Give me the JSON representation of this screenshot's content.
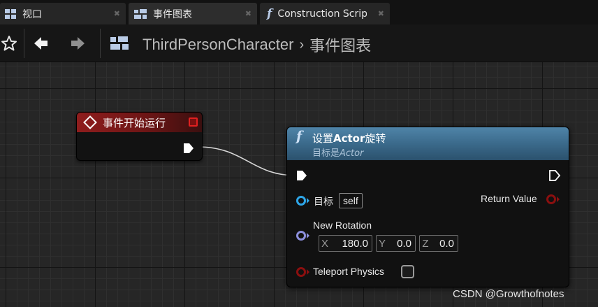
{
  "tabs": [
    {
      "label": "视口",
      "icon": "viewport-icon"
    },
    {
      "label": "事件图表",
      "icon": "event-graph-icon"
    },
    {
      "label": "Construction Scrip",
      "icon": "function-icon"
    }
  ],
  "toolbar": {
    "buttons": [
      "favorite-star-icon",
      "back-arrow-icon",
      "forward-arrow-icon",
      "blueprint-graph-icon"
    ],
    "breadcrumb": {
      "root": "ThirdPersonCharacter",
      "separator": "›",
      "current": "事件图表"
    }
  },
  "event_node": {
    "title": "事件开始运行",
    "header_color": "#8f1d1d"
  },
  "function_node": {
    "title_prefix": "设置",
    "title_bold": "Actor",
    "title_suffix": "旋转",
    "subtitle_prefix": "目标是",
    "subtitle_italic": "Actor",
    "header_color": "#3b6a8b",
    "pins": {
      "target_label": "目标",
      "target_default": "self",
      "return_label": "Return Value",
      "rotation_label": "New Rotation",
      "rotation": {
        "x_label": "X",
        "x_value": "180.0",
        "y_label": "Y",
        "y_value": "0.0",
        "z_label": "Z",
        "z_value": "0.0"
      },
      "teleport_label": "Teleport Physics",
      "teleport_checked": false
    }
  },
  "colors": {
    "object_pin": "#2ea6e8",
    "rotator_pin": "#8c8fdc",
    "bool_pin": "#8b0f0f",
    "exec_pin": "#ffffff"
  },
  "watermark": "CSDN @Growthofnotes"
}
